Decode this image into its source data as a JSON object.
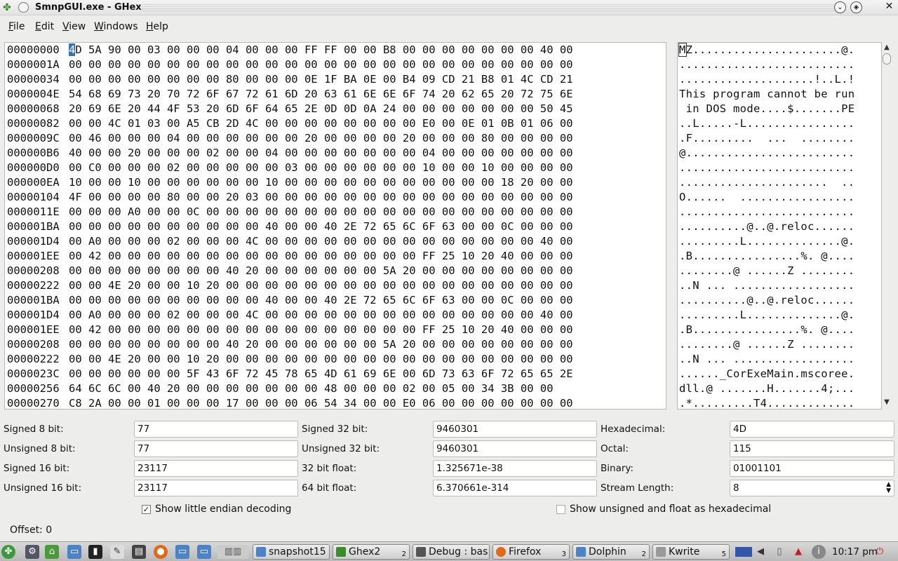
{
  "window": {
    "title": "SmnpGUI.exe - GHex"
  },
  "menu": [
    "File",
    "Edit",
    "View",
    "Windows",
    "Help"
  ],
  "hex": {
    "rows": [
      {
        "offset": "00000000",
        "hex": "4D 5A 90 00 03 00 00 00 04 00 00 00 FF FF 00 00 B8 00 00 00 00 00 00 00 40 00",
        "ascii": "MZ......................@."
      },
      {
        "offset": "0000001A",
        "hex": "00 00 00 00 00 00 00 00 00 00 00 00 00 00 00 00 00 00 00 00 00 00 00 00 00 00",
        "ascii": ".........................."
      },
      {
        "offset": "00000034",
        "hex": "00 00 00 00 00 00 00 00 80 00 00 00 0E 1F BA 0E 00 B4 09 CD 21 B8 01 4C CD 21",
        "ascii": "....................!..L.!"
      },
      {
        "offset": "0000004E",
        "hex": "54 68 69 73 20 70 72 6F 67 72 61 6D 20 63 61 6E 6E 6F 74 20 62 65 20 72 75 6E",
        "ascii": "This program cannot be run"
      },
      {
        "offset": "00000068",
        "hex": "20 69 6E 20 44 4F 53 20 6D 6F 64 65 2E 0D 0D 0A 24 00 00 00 00 00 00 00 50 45",
        "ascii": " in DOS mode....$.......PE"
      },
      {
        "offset": "00000082",
        "hex": "00 00 4C 01 03 00 A5 CB 2D 4C 00 00 00 00 00 00 00 00 E0 00 0E 01 0B 01 06 00",
        "ascii": "..L.....-L................"
      },
      {
        "offset": "0000009C",
        "hex": "00 46 00 00 00 04 00 00 00 00 00 00 20 00 00 00 00 20 00 00 00 80 00 00 00 00",
        "ascii": ".F.........  ...  ........"
      },
      {
        "offset": "000000B6",
        "hex": "40 00 00 20 00 00 00 02 00 00 04 00 00 00 00 00 00 00 04 00 00 00 00 00 00 00",
        "ascii": "@........................."
      },
      {
        "offset": "000000D0",
        "hex": "00 C0 00 00 00 02 00 00 00 00 00 03 00 00 00 00 00 00 10 00 00 10 00 00 00 00",
        "ascii": ".........................."
      },
      {
        "offset": "000000EA",
        "hex": "10 00 00 10 00 00 00 00 00 00 10 00 00 00 00 00 00 00 00 00 00 00 18 20 00 00",
        "ascii": "......................  .."
      },
      {
        "offset": "00000104",
        "hex": "4F 00 00 00 00 80 00 00 20 03 00 00 00 00 00 00 00 00 00 00 00 00 00 00 00 00",
        "ascii": "O......  ................."
      },
      {
        "offset": "0000011E",
        "hex": "00 00 00 A0 00 00 0C 00 00 00 00 00 00 00 00 00 00 00 00 00 00 00 00 00 00 00",
        "ascii": ".........................."
      },
      {
        "offset": "000001BA",
        "hex": "00 00 00 00 00 00 00 00 00 00 40 00 00 40 2E 72 65 6C 6F 63 00 00 0C 00 00 00",
        "ascii": "..........@..@.reloc......"
      },
      {
        "offset": "000001D4",
        "hex": "00 A0 00 00 00 02 00 00 00 4C 00 00 00 00 00 00 00 00 00 00 00 00 00 00 40 00",
        "ascii": ".........L..............@."
      },
      {
        "offset": "000001EE",
        "hex": "00 42 00 00 00 00 00 00 00 00 00 00 00 00 00 00 00 00 FF 25 10 20 40 00 00 00",
        "ascii": ".B................%. @...."
      },
      {
        "offset": "00000208",
        "hex": "00 00 00 00 00 00 00 00 40 20 00 00 00 00 00 00 5A 20 00 00 00 00 00 00 00 00",
        "ascii": "........@ ......Z ........"
      },
      {
        "offset": "00000222",
        "hex": "00 00 4E 20 00 00 10 20 00 00 00 00 00 00 00 00 00 00 00 00 00 00 00 00 00 00",
        "ascii": "..N ... .................."
      },
      {
        "offset": "000001BA",
        "hex": "00 00 00 00 00 00 00 00 00 00 40 00 00 40 2E 72 65 6C 6F 63 00 00 0C 00 00 00",
        "ascii": "..........@..@.reloc......"
      },
      {
        "offset": "000001D4",
        "hex": "00 A0 00 00 00 02 00 00 00 4C 00 00 00 00 00 00 00 00 00 00 00 00 00 00 40 00",
        "ascii": ".........L..............@."
      },
      {
        "offset": "000001EE",
        "hex": "00 42 00 00 00 00 00 00 00 00 00 00 00 00 00 00 00 00 FF 25 10 20 40 00 00 00",
        "ascii": ".B................%. @...."
      },
      {
        "offset": "00000208",
        "hex": "00 00 00 00 00 00 00 00 40 20 00 00 00 00 00 00 5A 20 00 00 00 00 00 00 00 00",
        "ascii": "........@ ......Z ........"
      },
      {
        "offset": "00000222",
        "hex": "00 00 4E 20 00 00 10 20 00 00 00 00 00 00 00 00 00 00 00 00 00 00 00 00 00 00",
        "ascii": "..N ... .................."
      },
      {
        "offset": "0000023C",
        "hex": "00 00 00 00 00 00 5F 43 6F 72 45 78 65 4D 61 69 6E 00 6D 73 63 6F 72 65 65 2E",
        "ascii": "......_CorExeMain.mscoree."
      },
      {
        "offset": "00000256",
        "hex": "64 6C 6C 00 40 20 00 00 00 00 00 00 00 48 00 00 00 02 00 05 00 34 3B 00 00",
        "ascii": "dll.@ .......H.......4;..."
      },
      {
        "offset": "00000270",
        "hex": "C8 2A 00 00 01 00 00 00 17 00 00 00 06 54 34 00 00 E0 06 00 00 00 00 00 00 00",
        "ascii": ".*.........T4............."
      }
    ]
  },
  "decode": {
    "signed8_label": "Signed 8 bit:",
    "signed8": "77",
    "unsigned8_label": "Unsigned 8 bit:",
    "unsigned8": "77",
    "signed16_label": "Signed 16 bit:",
    "signed16": "23117",
    "unsigned16_label": "Unsigned 16 bit:",
    "unsigned16": "23117",
    "signed32_label": "Signed 32 bit:",
    "signed32": "9460301",
    "unsigned32_label": "Unsigned 32 bit:",
    "unsigned32": "9460301",
    "float32_label": "32 bit float:",
    "float32": "1.325671e-38",
    "float64_label": "64 bit float:",
    "float64": "6.370661e-314",
    "hex_label": "Hexadecimal:",
    "hex": "4D",
    "octal_label": "Octal:",
    "octal": "115",
    "binary_label": "Binary:",
    "binary": "01001101",
    "stream_label": "Stream Length:",
    "stream": "8",
    "little_endian_label": "Show little endian decoding",
    "unsigned_hex_label": "Show unsigned and float as hexadecimal"
  },
  "status": {
    "offset": "Offset: 0"
  },
  "taskbar": {
    "tasks": [
      {
        "label": "snapshot15",
        "count": ""
      },
      {
        "label": "Ghex2",
        "count": "2"
      },
      {
        "label": "Debug : bas",
        "count": ""
      },
      {
        "label": "Firefox",
        "count": "3"
      },
      {
        "label": "Dolphin",
        "count": "2"
      },
      {
        "label": "Kwrite",
        "count": "5"
      }
    ],
    "clock": "10:17 pm"
  },
  "colors": {
    "selection": "#3b6fb6",
    "kde_green": "#3c8c2c"
  }
}
